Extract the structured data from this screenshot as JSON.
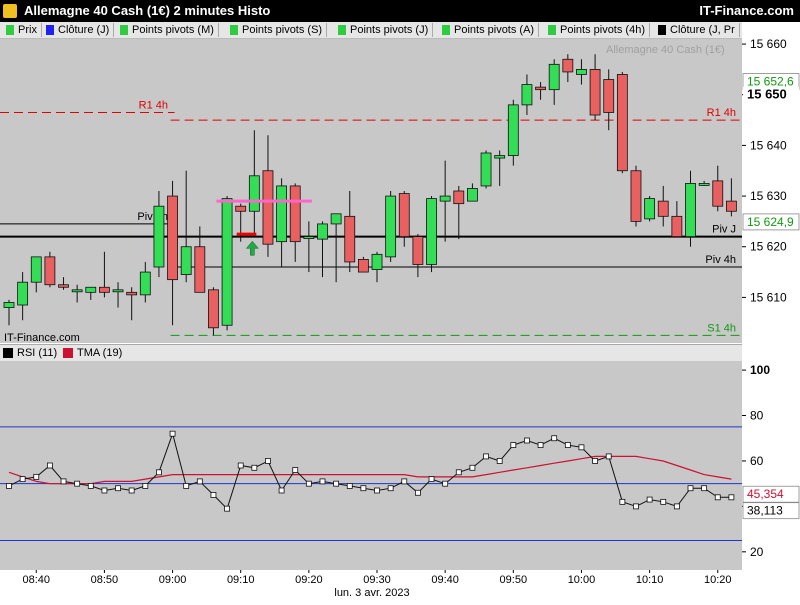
{
  "header": {
    "title": "Allemagne 40 Cash (1€) 2 minutes Histo",
    "brand": "IT-Finance.com"
  },
  "legend": {
    "items": [
      {
        "label": "Prix",
        "color": "#2ecc40"
      },
      {
        "label": "Clôture (J)",
        "color": "#2222ee"
      },
      {
        "label": "Points pivots (M)",
        "color": "#2ecc40"
      },
      {
        "label": "Points pivots (S)",
        "color": "#2ecc40"
      },
      {
        "label": "Points pivots (J)",
        "color": "#2ecc40"
      },
      {
        "label": "Points pivots (A)",
        "color": "#2ecc40"
      },
      {
        "label": "Points pivots (4h)",
        "color": "#2ecc40"
      },
      {
        "label": "Clôture (J, Pr",
        "color": "#000000"
      }
    ]
  },
  "watermark": "Allemagne 40 Cash (1€)",
  "source_label": "IT-Finance.com",
  "date_label": "lun. 3 avr. 2023",
  "indicator_legend": [
    {
      "label": "RSI (11)",
      "color": "#000000"
    },
    {
      "label": "TMA (19)",
      "color": "#cc1133"
    }
  ],
  "colors": {
    "up": "#33dd55",
    "down": "#e86060",
    "pane_bg": "#c8c8c8",
    "resistance": "#e00000",
    "support": "#119911",
    "pivot": "#000000",
    "rsi_band": "#2233cc",
    "tma": "#cc1133"
  },
  "chart_data": [
    {
      "type": "candlestick",
      "x_ticks": [
        "08:40",
        "08:50",
        "09:00",
        "09:10",
        "09:20",
        "09:30",
        "09:40",
        "09:50",
        "10:00",
        "10:10",
        "10:20"
      ],
      "x_tick_index": [
        2,
        7,
        12,
        17,
        22,
        27,
        32,
        37,
        42,
        47,
        52
      ],
      "y_ticks": [
        15610,
        15620,
        15630,
        15640,
        15650,
        15660
      ],
      "y_tick_labels": [
        "15 610",
        "15 620",
        "15 630",
        "15 640",
        "15 650",
        "15 660"
      ],
      "ylim": [
        15601,
        15661
      ],
      "candles": [
        {
          "o": 15608.0,
          "h": 15609.5,
          "l": 15604.5,
          "c": 15609.0
        },
        {
          "o": 15608.5,
          "h": 15615.0,
          "l": 15605.5,
          "c": 15613.0
        },
        {
          "o": 15613.0,
          "h": 15618.0,
          "l": 15611.0,
          "c": 15618.0
        },
        {
          "o": 15618.0,
          "h": 15619.0,
          "l": 15612.0,
          "c": 15612.5
        },
        {
          "o": 15612.5,
          "h": 15614.0,
          "l": 15611.5,
          "c": 15612.0
        },
        {
          "o": 15611.5,
          "h": 15612.5,
          "l": 15609.0,
          "c": 15611.5
        },
        {
          "o": 15611.0,
          "h": 15612.0,
          "l": 15609.5,
          "c": 15612.0
        },
        {
          "o": 15612.0,
          "h": 15619.0,
          "l": 15610.0,
          "c": 15611.0
        },
        {
          "o": 15611.5,
          "h": 15613.0,
          "l": 15608.0,
          "c": 15611.5
        },
        {
          "o": 15611.0,
          "h": 15612.0,
          "l": 15605.5,
          "c": 15610.5
        },
        {
          "o": 15610.5,
          "h": 15617.0,
          "l": 15609.0,
          "c": 15615.0
        },
        {
          "o": 15616.0,
          "h": 15631.0,
          "l": 15614.0,
          "c": 15628.0
        },
        {
          "o": 15630.0,
          "h": 15633.0,
          "l": 15604.5,
          "c": 15613.5
        },
        {
          "o": 15614.5,
          "h": 15635.0,
          "l": 15613.0,
          "c": 15620.0
        },
        {
          "o": 15620.0,
          "h": 15624.0,
          "l": 15611.0,
          "c": 15611.0
        },
        {
          "o": 15611.5,
          "h": 15612.0,
          "l": 15602.5,
          "c": 15604.0
        },
        {
          "o": 15604.5,
          "h": 15630.0,
          "l": 15603.5,
          "c": 15629.5
        },
        {
          "o": 15628.0,
          "h": 15628.5,
          "l": 15621.0,
          "c": 15627.0
        },
        {
          "o": 15627.0,
          "h": 15643.0,
          "l": 15622.0,
          "c": 15634.0
        },
        {
          "o": 15635.0,
          "h": 15642.0,
          "l": 15618.0,
          "c": 15620.5
        },
        {
          "o": 15621.0,
          "h": 15633.5,
          "l": 15616.0,
          "c": 15632.0
        },
        {
          "o": 15632.0,
          "h": 15632.5,
          "l": 15617.0,
          "c": 15621.0
        },
        {
          "o": 15622.0,
          "h": 15625.0,
          "l": 15615.0,
          "c": 15622.0
        },
        {
          "o": 15621.5,
          "h": 15625.0,
          "l": 15614.0,
          "c": 15624.5
        },
        {
          "o": 15624.5,
          "h": 15626.0,
          "l": 15613.0,
          "c": 15626.5
        },
        {
          "o": 15626.0,
          "h": 15631.0,
          "l": 15615.0,
          "c": 15617.0
        },
        {
          "o": 15617.5,
          "h": 15618.0,
          "l": 15615.0,
          "c": 15615.0
        },
        {
          "o": 15615.5,
          "h": 15619.0,
          "l": 15613.0,
          "c": 15618.5
        },
        {
          "o": 15618.0,
          "h": 15631.0,
          "l": 15617.0,
          "c": 15630.0
        },
        {
          "o": 15630.5,
          "h": 15631.0,
          "l": 15620.0,
          "c": 15622.0
        },
        {
          "o": 15622.0,
          "h": 15622.5,
          "l": 15614.0,
          "c": 15616.5
        },
        {
          "o": 15616.5,
          "h": 15630.0,
          "l": 15615.0,
          "c": 15629.5
        },
        {
          "o": 15629.0,
          "h": 15637.0,
          "l": 15621.0,
          "c": 15630.0
        },
        {
          "o": 15631.0,
          "h": 15632.0,
          "l": 15621.5,
          "c": 15628.5
        },
        {
          "o": 15629.0,
          "h": 15632.5,
          "l": 15629.0,
          "c": 15631.5
        },
        {
          "o": 15632.0,
          "h": 15639.0,
          "l": 15631.5,
          "c": 15638.5
        },
        {
          "o": 15637.5,
          "h": 15639.0,
          "l": 15632.0,
          "c": 15638.0
        },
        {
          "o": 15638.0,
          "h": 15649.0,
          "l": 15636.0,
          "c": 15648.0
        },
        {
          "o": 15648.0,
          "h": 15654.0,
          "l": 15646.0,
          "c": 15652.0
        },
        {
          "o": 15651.5,
          "h": 15652.5,
          "l": 15649.0,
          "c": 15651.0
        },
        {
          "o": 15651.0,
          "h": 15657.0,
          "l": 15648.0,
          "c": 15656.0
        },
        {
          "o": 15657.0,
          "h": 15658.0,
          "l": 15652.5,
          "c": 15654.5
        },
        {
          "o": 15654.0,
          "h": 15657.0,
          "l": 15652.0,
          "c": 15655.0
        },
        {
          "o": 15655.0,
          "h": 15658.0,
          "l": 15645.0,
          "c": 15646.0
        },
        {
          "o": 15653.0,
          "h": 15655.0,
          "l": 15643.0,
          "c": 15646.5
        },
        {
          "o": 15654.0,
          "h": 15654.5,
          "l": 15634.5,
          "c": 15635.0
        },
        {
          "o": 15635.0,
          "h": 15636.0,
          "l": 15624.0,
          "c": 15625.0
        },
        {
          "o": 15625.5,
          "h": 15630.0,
          "l": 15625.0,
          "c": 15629.5
        },
        {
          "o": 15629.0,
          "h": 15632.0,
          "l": 15624.0,
          "c": 15626.0
        },
        {
          "o": 15626.0,
          "h": 15629.0,
          "l": 15622.0,
          "c": 15622.0
        },
        {
          "o": 15622.0,
          "h": 15635.0,
          "l": 15620.0,
          "c": 15632.5
        },
        {
          "o": 15632.5,
          "h": 15633.0,
          "l": 15632.0,
          "c": 15632.5
        },
        {
          "o": 15633.0,
          "h": 15636.0,
          "l": 15627.0,
          "c": 15628.0
        },
        {
          "o": 15629.0,
          "h": 15633.5,
          "l": 15626.0,
          "c": 15627.0
        }
      ],
      "levels": [
        {
          "label": "R1 4h",
          "value": 15645.0,
          "style": "dashed",
          "color": "#e00000",
          "from": 12,
          "side": "right"
        },
        {
          "label": "R1 4h",
          "value": 15646.5,
          "style": "dashed",
          "color": "#e00000",
          "from": 0,
          "to": 12,
          "side": "left"
        },
        {
          "label": "Piv 4h",
          "value": 15616.0,
          "style": "solid",
          "color": "#000000",
          "from": 12,
          "side": "right"
        },
        {
          "label": "Piv 4h",
          "value": 15624.5,
          "style": "solid",
          "color": "#000000",
          "from": 0,
          "to": 12,
          "side": "left"
        },
        {
          "label": "Piv J",
          "value": 15622.0,
          "style": "solid-thick",
          "color": "#000000",
          "from": 0,
          "side": "right"
        },
        {
          "label": "S1 4h",
          "value": 15602.5,
          "style": "dashed",
          "color": "#119911",
          "from": 12,
          "side": "right"
        }
      ],
      "markers": [
        {
          "type": "pink-line",
          "value": 15629.0,
          "from": 15,
          "to": 22
        },
        {
          "type": "red-line",
          "value": 15622.5,
          "from": 17,
          "to": 18
        },
        {
          "type": "up-arrow",
          "value": 15619.5,
          "at": 18
        }
      ],
      "price_tags": [
        {
          "label": "15 652,6",
          "value": 15652.6,
          "color": "#119911"
        },
        {
          "label": "15 624,9",
          "value": 15624.9,
          "color": "#119911"
        },
        {
          "label": "15 650",
          "value": 15650.0,
          "color": "#000000"
        }
      ]
    },
    {
      "type": "line",
      "title": "RSI (11)",
      "ylim": [
        12,
        104
      ],
      "y_ticks": [
        20,
        40,
        60,
        80,
        100
      ],
      "bands": [
        25,
        50,
        75
      ],
      "rsi": [
        49,
        52,
        53,
        58,
        51,
        50,
        49,
        47,
        48,
        47,
        49,
        55,
        72,
        49,
        51,
        45,
        39,
        58,
        57,
        60,
        47,
        56,
        50,
        51,
        50,
        49,
        48,
        47,
        48,
        51,
        46,
        52,
        50,
        55,
        57,
        62,
        60,
        67,
        69,
        67,
        70,
        67,
        66,
        60,
        62,
        42,
        40,
        43,
        42,
        40,
        48,
        48,
        44,
        44
      ],
      "tma": [
        55,
        53,
        51,
        50,
        50,
        50,
        50,
        51,
        51,
        51,
        52,
        53,
        54,
        54,
        54,
        54,
        54,
        54,
        54,
        54,
        54,
        54,
        54,
        54,
        54,
        54,
        54,
        54,
        54,
        54,
        53,
        53,
        53,
        53,
        53,
        54,
        55,
        56,
        57,
        58,
        59,
        60,
        61,
        62,
        62,
        62,
        62,
        61,
        60,
        58,
        56,
        54,
        53,
        52
      ],
      "tags": [
        {
          "label": "45,354",
          "value": 45.354,
          "color": "#cc1133"
        },
        {
          "label": "38,113",
          "value": 38.113,
          "color": "#000000"
        }
      ]
    }
  ]
}
